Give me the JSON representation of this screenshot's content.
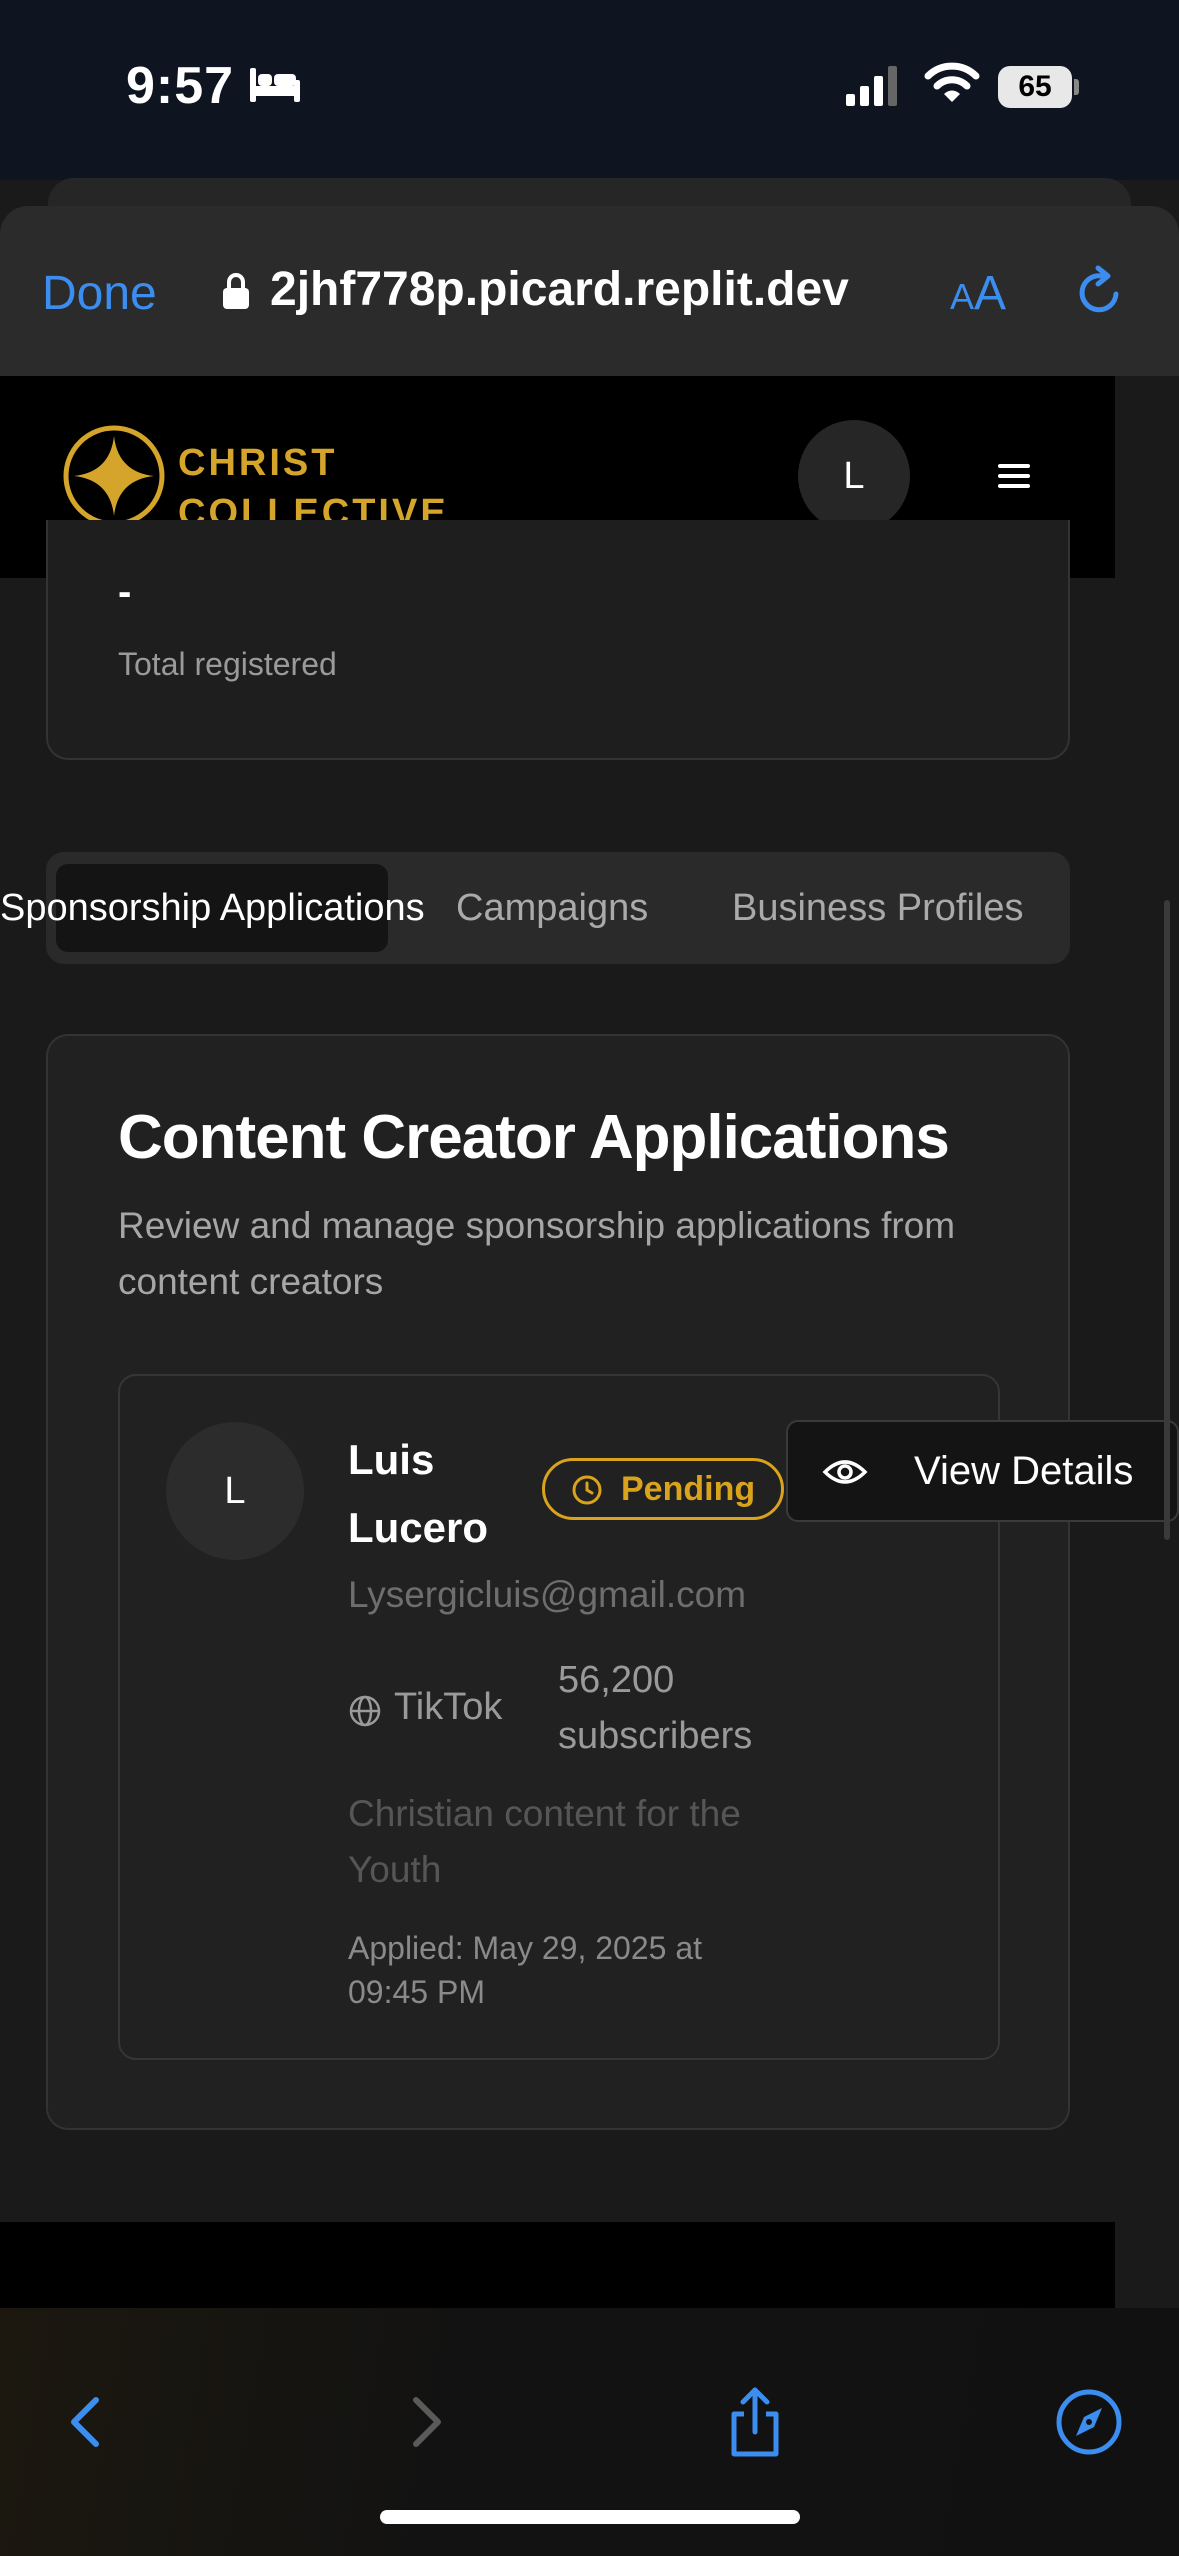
{
  "status_bar": {
    "time": "9:57",
    "battery": "65"
  },
  "browser": {
    "done_label": "Done",
    "url": "2jhf778p.picard.replit.dev",
    "text_size_label_small": "A",
    "text_size_label_large": "A"
  },
  "site": {
    "logo_line1": "CHRIST",
    "logo_line2": "COLLECTIVE",
    "user_initial": "L",
    "accent_color": "#d4a52a"
  },
  "stats": {
    "value": "-",
    "label": "Total registered"
  },
  "tabs": [
    {
      "label": "Sponsorship Applications",
      "active": true
    },
    {
      "label": "Campaigns",
      "active": false
    },
    {
      "label": "Business Profiles",
      "active": false
    }
  ],
  "main": {
    "title": "Content Creator Applications",
    "description": "Review and manage sponsorship applications from content creators"
  },
  "application": {
    "initial": "L",
    "name": "Luis Lucero",
    "status": "Pending",
    "status_color": "#d9a31c",
    "email": "Lysergicluis@gmail.com",
    "platform": "TikTok",
    "subscribers": "56,200 subscribers",
    "bio": "Christian content for the Youth",
    "applied": "Applied: May 29, 2025 at 09:45 PM",
    "view_label": "View Details"
  },
  "toolbar_icons": [
    "back-icon",
    "forward-icon",
    "share-icon",
    "compass-icon"
  ],
  "link_color": "#3b8ef0"
}
